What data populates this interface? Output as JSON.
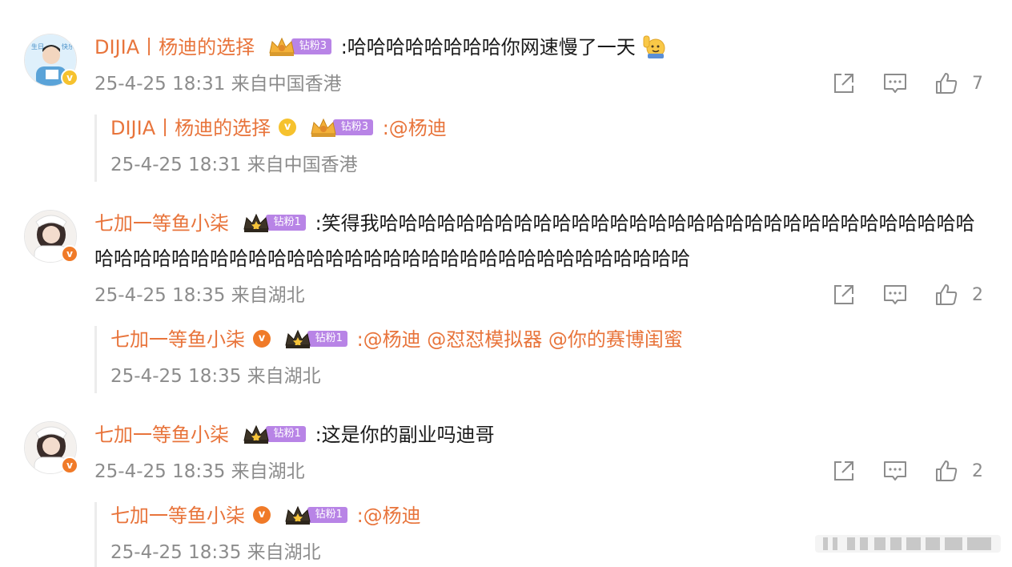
{
  "comments": [
    {
      "user": "DIJIA丨杨迪的选择",
      "fan_label": "钻粉3",
      "text": ":哈哈哈哈哈哈哈哈你网速慢了一天",
      "time": "25-4-25 18:31 来自中国香港",
      "likes": "7",
      "reply": {
        "user": "DIJIA丨杨迪的选择",
        "fan_label": "钻粉3",
        "text": ":@杨迪",
        "time": "25-4-25 18:31 来自中国香港"
      }
    },
    {
      "user": "七加一等鱼小柒",
      "fan_label": "钻粉1",
      "text_line1": ":笑得我哈哈哈哈哈哈哈哈哈哈哈哈哈哈哈哈哈哈哈哈哈哈哈哈哈哈哈哈哈哈哈",
      "text_line2": "哈哈哈哈哈哈哈哈哈哈哈哈哈哈哈哈哈哈哈哈哈哈哈哈哈哈哈哈哈哈哈",
      "time": "25-4-25 18:35 来自湖北",
      "likes": "2",
      "reply": {
        "user": "七加一等鱼小柒",
        "fan_label": "钻粉1",
        "text": ":@杨迪 @怼怼模拟器 @你的赛博闺蜜",
        "time": "25-4-25 18:35 来自湖北"
      }
    },
    {
      "user": "七加一等鱼小柒",
      "fan_label": "钻粉1",
      "text": ":这是你的副业吗迪哥",
      "time": "25-4-25 18:35 来自湖北",
      "likes": "2",
      "reply": {
        "user": "七加一等鱼小柒",
        "fan_label": "钻粉1",
        "text": ":@杨迪",
        "time": "25-4-25 18:35 来自湖北"
      }
    }
  ],
  "icons": {
    "share": "share-icon",
    "comment": "comment-icon",
    "like": "like-icon"
  },
  "colors": {
    "username": "#e8743b",
    "meta": "#8c8c8c",
    "fan_tag": "#b884e6",
    "verified_gold": "#f6c22e",
    "verified_orange": "#f07a28"
  }
}
